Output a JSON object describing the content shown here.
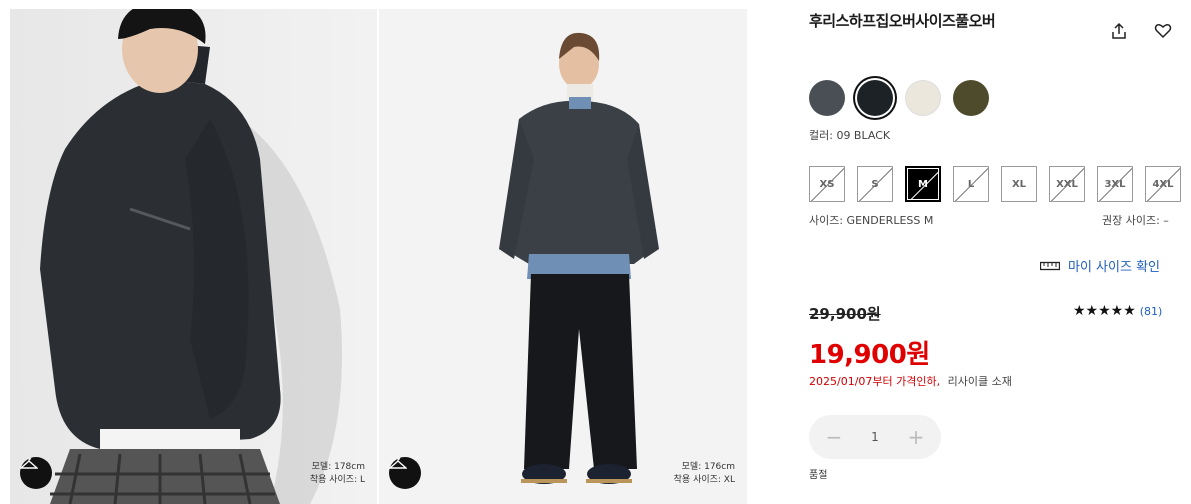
{
  "product": {
    "title": "후리스하프집오버사이즈풀오버",
    "color_label": "컬러: 09 BLACK",
    "size_label": "사이즈: GENDERLESS M",
    "recommended_size": "권장 사이즈: –",
    "my_size_link": "마이 사이즈 확인",
    "original_price": "29,900원",
    "sale_price": "19,900원",
    "price_note": "2025/01/07부터 가격인하,",
    "material_note": "리사이클 소재",
    "rating_stars": "★★★★★",
    "review_count": "(81)",
    "quantity": "1",
    "quantity_minus": "−",
    "quantity_plus": "+",
    "quantity_label": "품절"
  },
  "colors": [
    {
      "name": "gray",
      "hex": "#4a4f55",
      "selected": false
    },
    {
      "name": "black",
      "hex": "#1d2227",
      "selected": true
    },
    {
      "name": "off-white",
      "hex": "#ece7dc",
      "selected": false
    },
    {
      "name": "olive",
      "hex": "#4d4b2c",
      "selected": false
    }
  ],
  "sizes": [
    {
      "label": "XS",
      "state": "out"
    },
    {
      "label": "S",
      "state": "out"
    },
    {
      "label": "M",
      "state": "selected"
    },
    {
      "label": "L",
      "state": "out"
    },
    {
      "label": "XL",
      "state": "available"
    },
    {
      "label": "XXL",
      "state": "out"
    },
    {
      "label": "3XL",
      "state": "out"
    },
    {
      "label": "4XL",
      "state": "out"
    }
  ],
  "images": [
    {
      "model_height": "모델: 178cm",
      "model_size": "착용 사이즈: L",
      "icon": "hanger-icon"
    },
    {
      "model_height": "모델: 176cm",
      "model_size": "착용 사이즈: XL",
      "icon": "hanger-icon"
    }
  ],
  "icons": {
    "share": "share-icon",
    "wishlist": "heart-icon",
    "ruler": "ruler-icon"
  }
}
